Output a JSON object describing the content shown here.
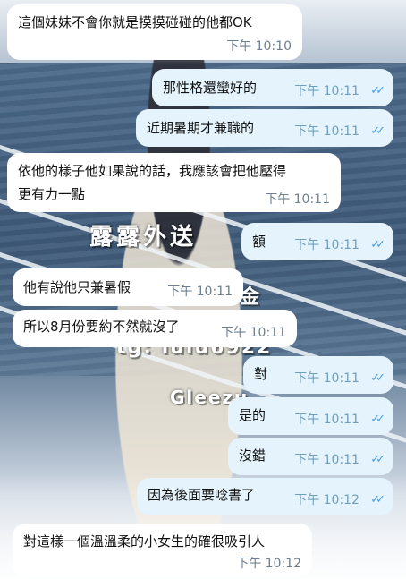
{
  "chat": {
    "background_watermark": [
      "露露外送",
      "金",
      "tg: lulu6922",
      "Gleezu"
    ],
    "messages": [
      {
        "dir": "in",
        "text": "這個妹妹不會你就是摸摸碰碰的他都OK",
        "time": "下午 10:10"
      },
      {
        "dir": "out",
        "text": "那性格還蠻好的",
        "time": "下午 10:11"
      },
      {
        "dir": "out",
        "text": "近期暑期才兼職的",
        "time": "下午 10:11"
      },
      {
        "dir": "in",
        "text": "依他的樣子他如果說的話，我應該會把他壓得更有力一點",
        "line1": "依他的樣子他如果說的話，我應該會把他壓得",
        "line2": "更有力一點",
        "time": "下午 10:11"
      },
      {
        "dir": "out",
        "text": "額",
        "time": "下午 10:11"
      },
      {
        "dir": "in",
        "text": "他有說他只兼暑假",
        "time": "下午 10:11"
      },
      {
        "dir": "in",
        "text": "所以8月份要約不然就沒了",
        "time": "下午 10:11"
      },
      {
        "dir": "out",
        "text": "對",
        "time": "下午 10:11"
      },
      {
        "dir": "out",
        "text": "是的",
        "time": "下午 10:11"
      },
      {
        "dir": "out",
        "text": "沒錯",
        "time": "下午 10:11"
      },
      {
        "dir": "out",
        "text": "因為後面要唸書了",
        "time": "下午 10:12"
      },
      {
        "dir": "in",
        "text": "對這樣一個溫溫柔的小女生的確很吸引人",
        "time": "下午 10:12"
      }
    ],
    "read_ticks": "✓✓",
    "colors": {
      "incoming": "#ffffff",
      "outgoing": "#e4f3fc",
      "tick": "#4a9fe0"
    }
  }
}
